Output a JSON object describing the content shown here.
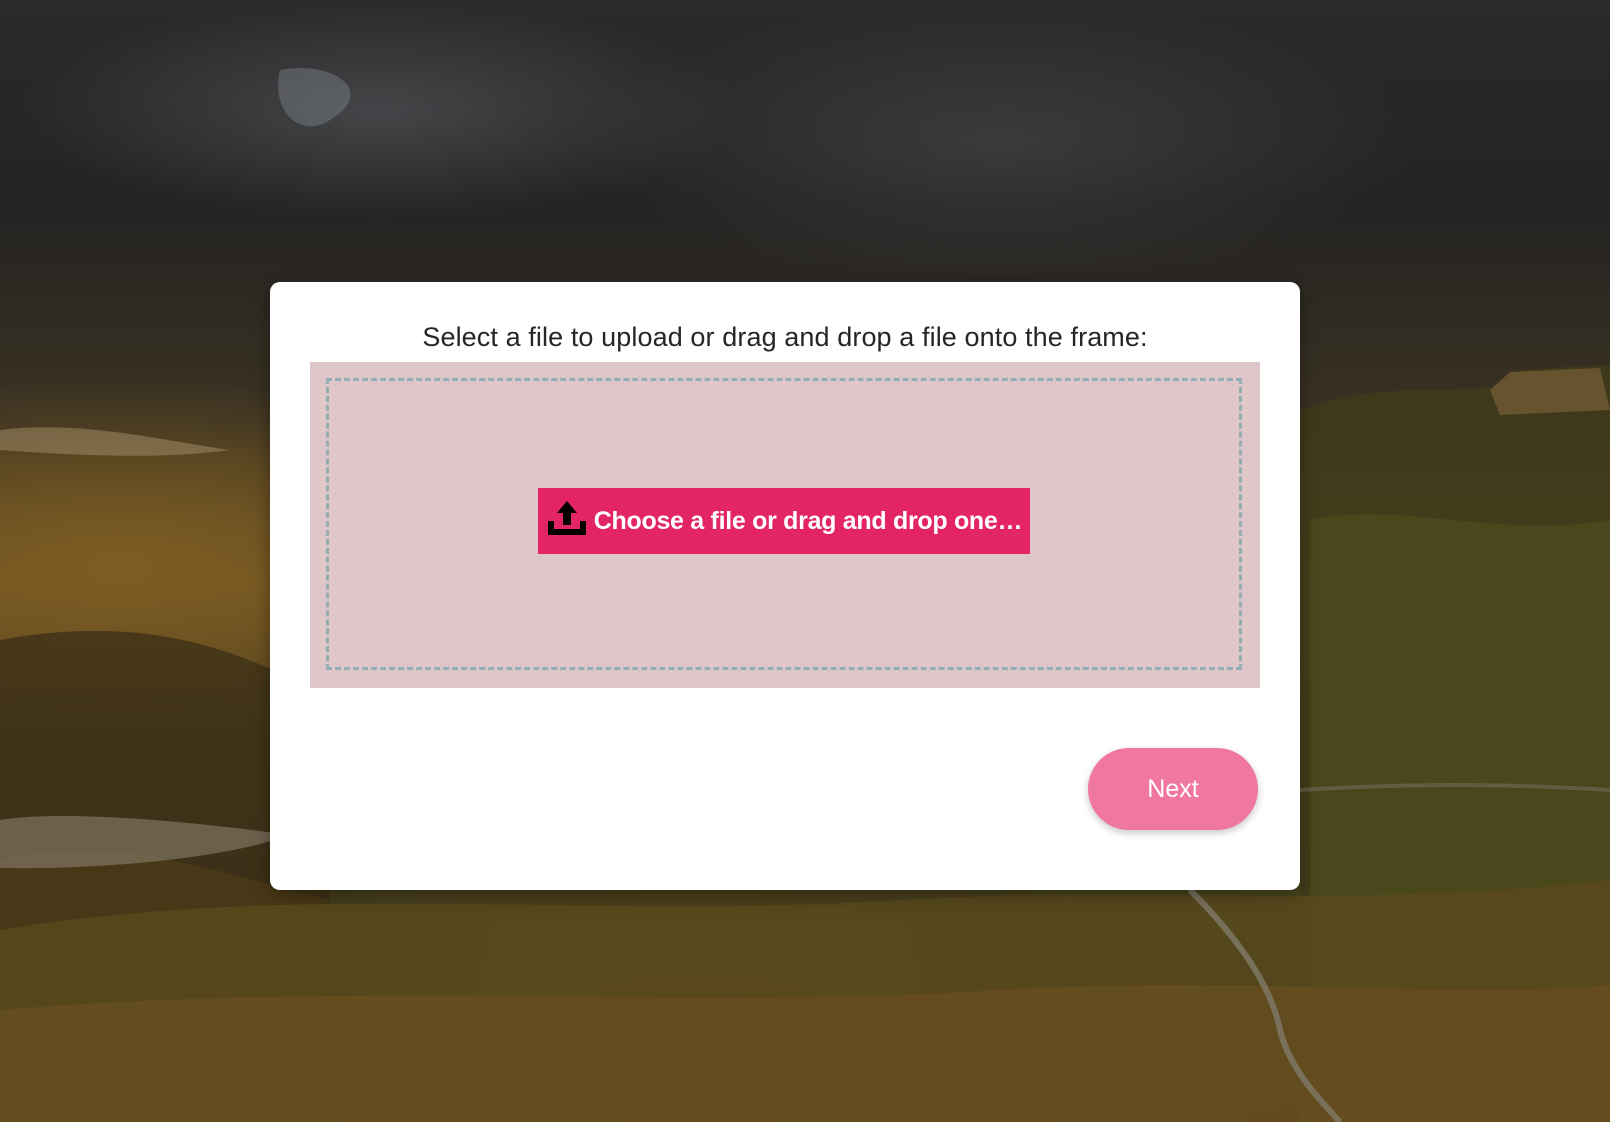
{
  "upload": {
    "instruction": "Select a file to upload or drag and drop a file onto the frame:",
    "choose_button_label": "Choose a file or drag and drop one…",
    "choose_button_icon": "upload-icon"
  },
  "actions": {
    "next_label": "Next"
  },
  "colors": {
    "accent": "#e42565",
    "next_button": "#f0779f",
    "dropzone_background": "#dfc7c9",
    "dropzone_dash": "#92aeb2"
  },
  "background": {
    "description_icon": "landscape-background"
  }
}
